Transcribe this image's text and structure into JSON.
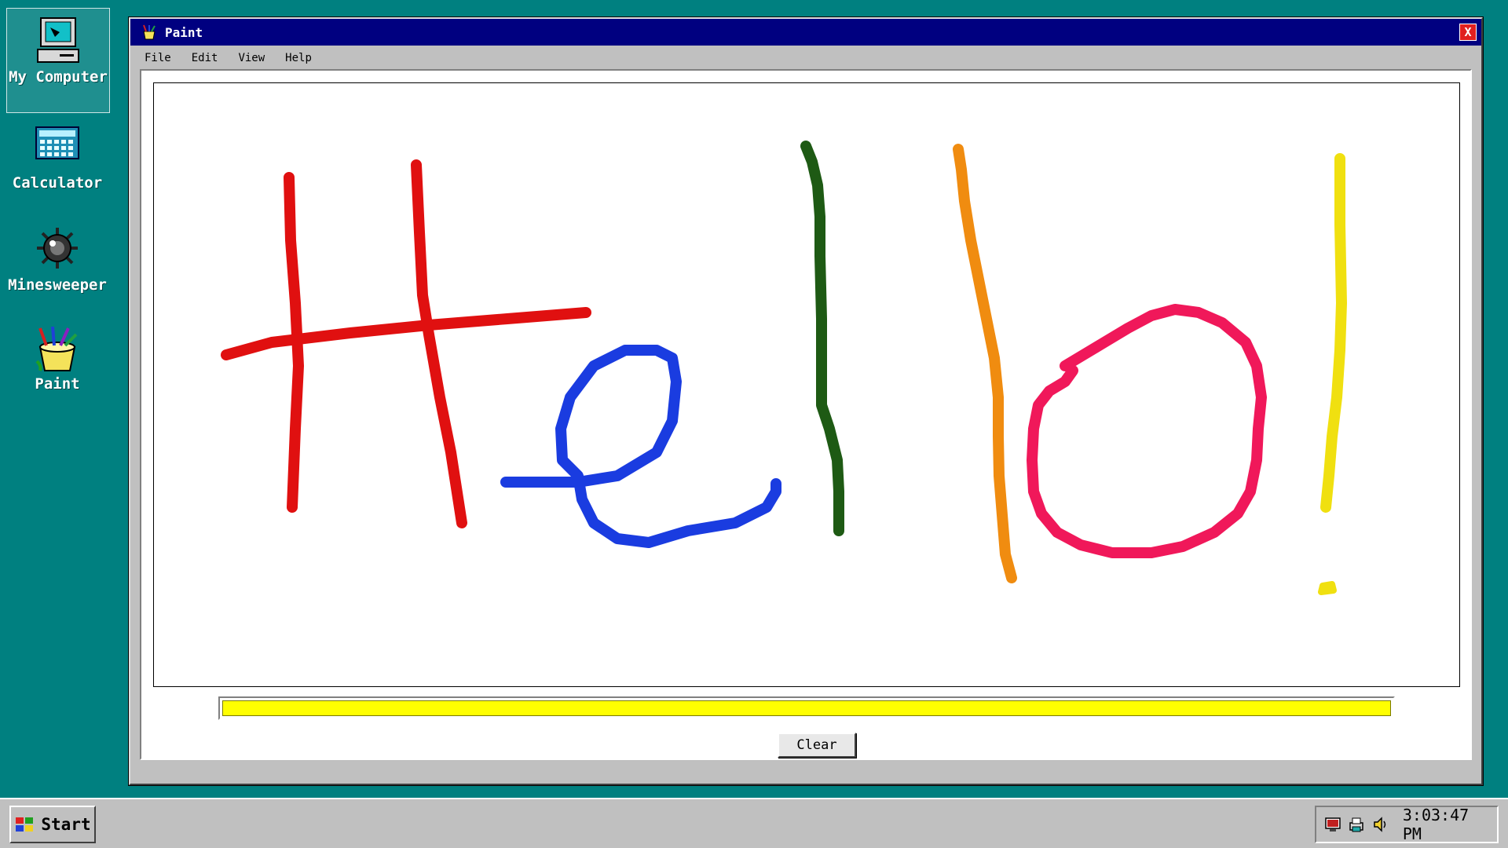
{
  "desktop": {
    "icons": [
      {
        "label": "My Computer",
        "icon": "computer-icon"
      },
      {
        "label": "Calculator",
        "icon": "calculator-icon"
      },
      {
        "label": "Minesweeper",
        "icon": "mine-icon"
      },
      {
        "label": "Paint",
        "icon": "paint-icon"
      }
    ]
  },
  "window": {
    "title": "Paint",
    "close_label": "X",
    "menu": [
      "File",
      "Edit",
      "View",
      "Help"
    ],
    "current_color": "#ffff00",
    "drawing_strokes": [
      {
        "color": "#e01010"
      },
      {
        "color": "#e01010"
      },
      {
        "color": "#e01010"
      },
      {
        "color": "#1a3ce0"
      },
      {
        "color": "#1e5a14"
      },
      {
        "color": "#f08c10"
      },
      {
        "color": "#f0185a"
      },
      {
        "color": "#f0e010"
      }
    ],
    "clear_label": "Clear"
  },
  "taskbar": {
    "start_label": "Start",
    "tray_icons": [
      "monitor-icon",
      "printer-icon",
      "speaker-icon"
    ],
    "clock": "3:03:47 PM"
  }
}
